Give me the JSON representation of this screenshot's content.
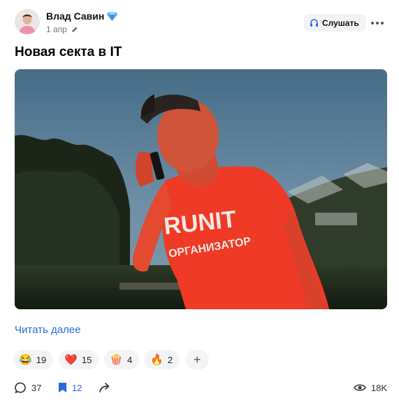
{
  "post": {
    "author": "Влад Савин",
    "date": "1 апр",
    "listen_label": "Слушать",
    "title": "Новая секта в IT",
    "read_more": "Читать далее"
  },
  "photo": {
    "shirt_line1": "RUNIT",
    "shirt_line2": "ОРГАНИЗАТОР"
  },
  "reactions": [
    {
      "emoji": "😂",
      "count": "19"
    },
    {
      "emoji": "❤️",
      "count": "15"
    },
    {
      "emoji": "🍿",
      "count": "4"
    },
    {
      "emoji": "🔥",
      "count": "2"
    }
  ],
  "add_reaction": "+",
  "stats": {
    "comments": "37",
    "saves": "12",
    "views": "18K"
  },
  "icons": {
    "verified": "diamond-icon",
    "edit": "pencil-icon",
    "listen": "headphones-icon",
    "more": "more-dots-icon",
    "comments": "comment-icon",
    "saves": "bookmark-icon",
    "share": "share-arrow-icon",
    "views": "eye-icon"
  },
  "colors": {
    "accent": "#2b6bd8",
    "chip_bg": "#f3f4f6",
    "shirt": "#ef3a25"
  }
}
